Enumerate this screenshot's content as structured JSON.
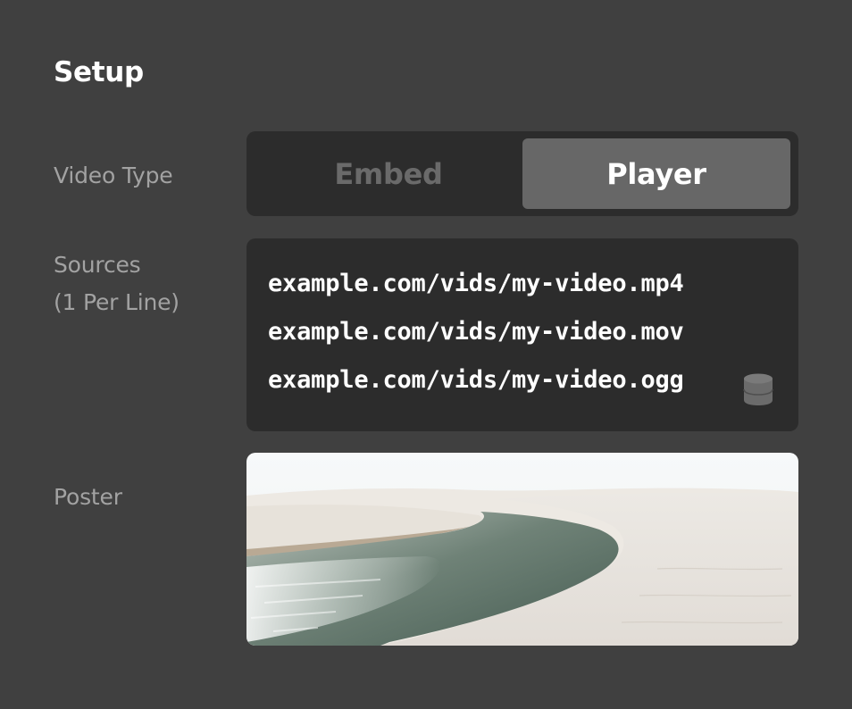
{
  "setup": {
    "title": "Setup"
  },
  "video_type": {
    "label": "Video Type",
    "options": [
      {
        "label": "Embed",
        "selected": false
      },
      {
        "label": "Player",
        "selected": true
      }
    ]
  },
  "sources": {
    "label_line1": "Sources",
    "label_line2": "(1 Per Line)",
    "lines": [
      "example.com/vids/my-video.mp4",
      "example.com/vids/my-video.mov",
      "example.com/vids/my-video.ogg"
    ],
    "icon": "database-icon"
  },
  "poster": {
    "label": "Poster",
    "image": "desert-lagoon-photo"
  },
  "colors": {
    "background": "#404040",
    "field_background": "#2c2c2c",
    "selected_segment": "#676767",
    "label_text": "#a2a2a2",
    "text": "#ffffff"
  }
}
